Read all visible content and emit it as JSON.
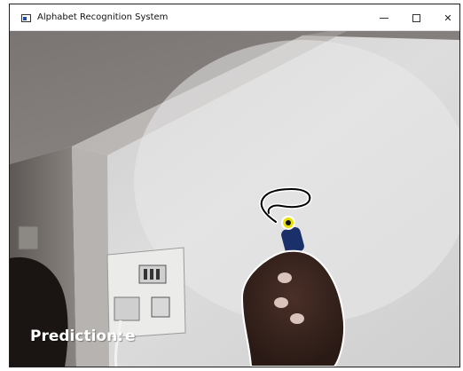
{
  "window": {
    "title": "Alphabet Recognition System"
  },
  "controls": {
    "minimize": "minimize-icon",
    "maximize": "maximize-icon",
    "close_glyph": "✕"
  },
  "prediction": {
    "label": "Prediction:",
    "value": "e"
  },
  "colors": {
    "titlebar": "#ffffff",
    "drawing_stroke": "#000000",
    "text": "#ffffff"
  }
}
